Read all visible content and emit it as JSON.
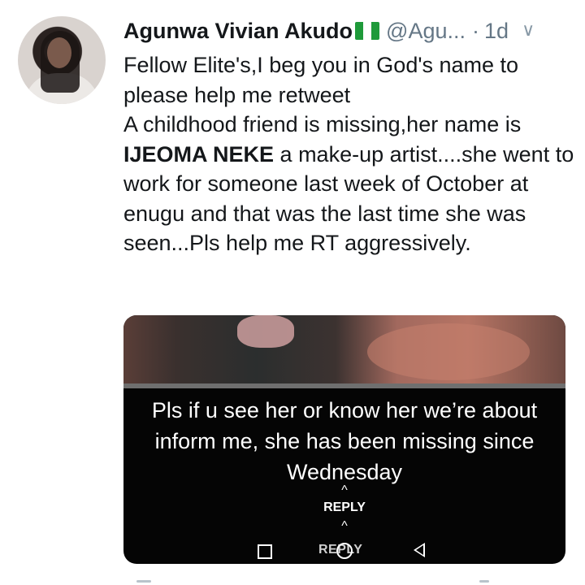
{
  "tweet": {
    "author": {
      "display_name": "Agunwa Vivian Akudo",
      "flag_icon": "nigeria-flag-icon",
      "handle": "@Agu...",
      "separator": "·",
      "time": "1d"
    },
    "menu_icon": "chevron-down-icon",
    "menu_glyph": "∨",
    "text_lines": {
      "p1": "Fellow Elite's,I beg you in God's name to please help me retweet",
      "p2_before": "A childhood friend is missing,her name is ",
      "p2_bold": "IJEOMA NEKE",
      "p2_after": " a make-up artist....she went to work for someone last week of October at enugu and that was the last time she was seen...Pls help me RT aggressively."
    },
    "media": {
      "caption": "Pls if u see her or know her we’re about inform me, she has been missing since Wednesday",
      "reply_label": "REPLY",
      "reply_arrow_glyph": "^",
      "faded_reply_label": "REPLY"
    }
  },
  "colors": {
    "text": "#14171a",
    "secondary": "#657786",
    "media_bg": "#050505",
    "flag_green": "#1f9a3a"
  }
}
